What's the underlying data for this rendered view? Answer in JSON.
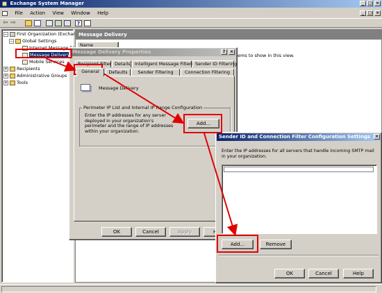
{
  "app": {
    "title": "Exchange System Manager",
    "menu": [
      "File",
      "Action",
      "View",
      "Window",
      "Help"
    ]
  },
  "tree": {
    "items": [
      {
        "label": "First Organization (Exchange)",
        "expander": "minus"
      },
      {
        "label": "Global Settings",
        "expander": "minus"
      },
      {
        "label": "Internet Message Formats",
        "expander": ""
      },
      {
        "label": "Message Delivery",
        "expander": ""
      },
      {
        "label": "Mobile Services",
        "expander": ""
      },
      {
        "label": "Recipients",
        "expander": "plus"
      },
      {
        "label": "Administrative Groups",
        "expander": "plus"
      },
      {
        "label": "Tools",
        "expander": "plus"
      }
    ]
  },
  "right_pane": {
    "header": "Message Delivery",
    "column_name": "Name",
    "empty_text": "There are no items to show in this view."
  },
  "properties_dialog": {
    "title": "Message Delivery Properties",
    "tabs_row1": [
      "Recipient Filtering",
      "Details",
      "Intelligent Message Filtering",
      "Sender ID Filtering"
    ],
    "tabs_row2": [
      "General",
      "Defaults",
      "Sender Filtering",
      "Connection Filtering"
    ],
    "icon_label": "Message Delivery",
    "group_title": "Perimeter IP List and Internal IP Range Configuration",
    "description": "Enter the IP addresses for any server deployed in your organization's perimeter and the range of IP addresses within your organization.",
    "add_button": "Add...",
    "ok": "OK",
    "cancel": "Cancel",
    "apply": "Apply",
    "help": "Help"
  },
  "config_dialog": {
    "title": "Sender ID and Connection Filter Configuration Settings",
    "instruction": "Enter the IP addresses for all servers that handle incoming SMTP mail in your organization.",
    "input_value": "",
    "add_button": "Add...",
    "remove_button": "Remove",
    "ok": "OK",
    "cancel": "Cancel",
    "help": "Help"
  },
  "colors": {
    "highlight": "#e00000",
    "title_active": "#0a246a",
    "face": "#d4d0c8"
  }
}
